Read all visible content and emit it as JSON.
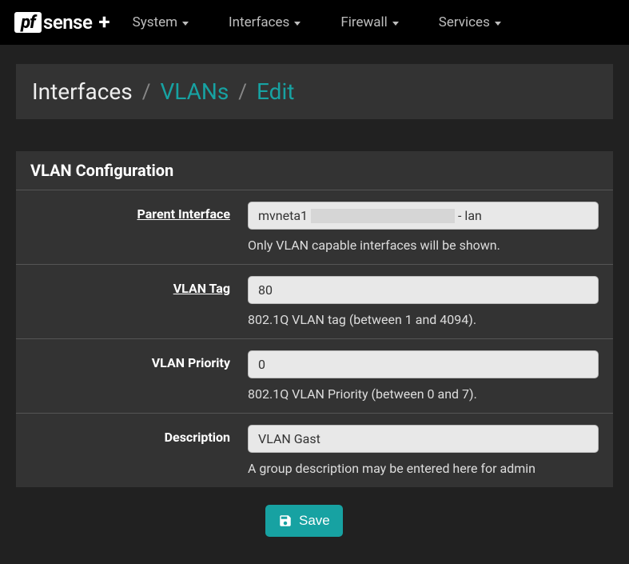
{
  "brand": {
    "pf": "pf",
    "sense": "sense",
    "plus": "+"
  },
  "nav": {
    "system": "System",
    "interfaces": "Interfaces",
    "firewall": "Firewall",
    "services": "Services"
  },
  "breadcrumb": {
    "root": "Interfaces",
    "level1": "VLANs",
    "level2": "Edit"
  },
  "panel": {
    "heading": "VLAN Configuration",
    "parent_interface_label": "Parent Interface",
    "parent_interface_value_prefix": "mvneta1",
    "parent_interface_value_suffix": "- lan",
    "parent_interface_help": "Only VLAN capable interfaces will be shown.",
    "vlan_tag_label": "VLAN Tag",
    "vlan_tag_value": "80",
    "vlan_tag_help": "802.1Q VLAN tag (between 1 and 4094).",
    "vlan_priority_label": "VLAN Priority",
    "vlan_priority_value": "0",
    "vlan_priority_help": "802.1Q VLAN Priority (between 0 and 7).",
    "description_label": "Description",
    "description_value": "VLAN Gast",
    "description_help": "A group description may be entered here for admin"
  },
  "buttons": {
    "save": "Save"
  }
}
